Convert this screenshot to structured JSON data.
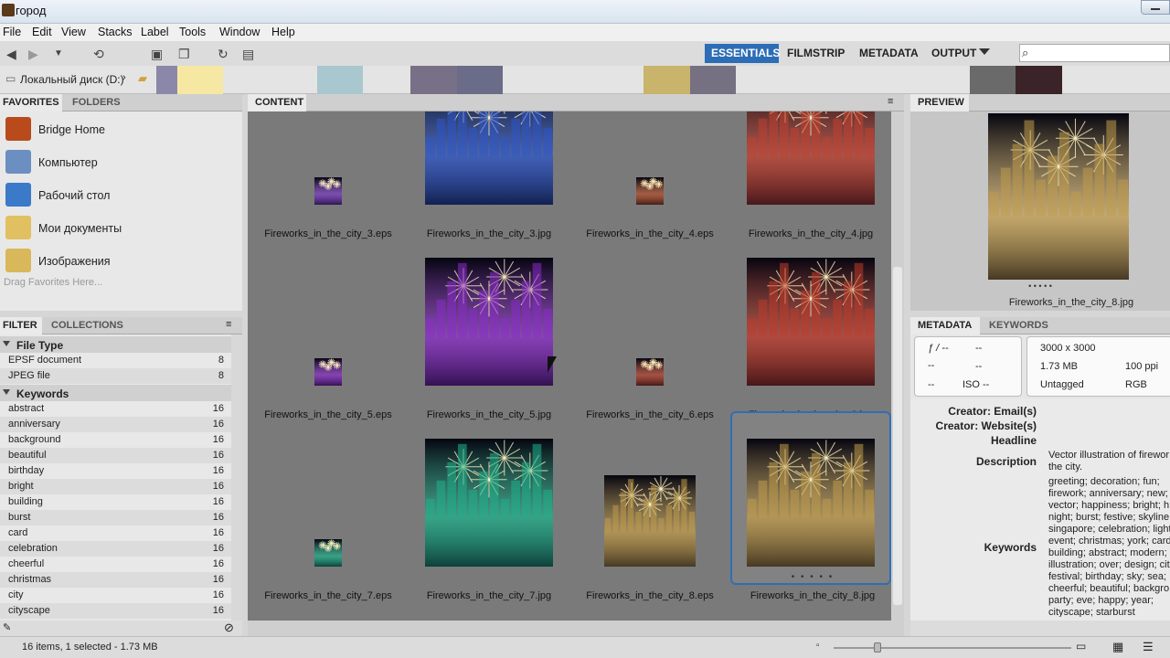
{
  "window": {
    "title": "город"
  },
  "menu": [
    "File",
    "Edit",
    "View",
    "Stacks",
    "Label",
    "Tools",
    "Window",
    "Help"
  ],
  "workspaces": {
    "active": "ESSENTIALS",
    "items": [
      "ESSENTIALS",
      "FILMSTRIP",
      "METADATA",
      "OUTPUT"
    ]
  },
  "search": {
    "placeholder": ""
  },
  "path": {
    "drive": "Локальный диск (D:)"
  },
  "favorites": {
    "tabs": [
      "FAVORITES",
      "FOLDERS"
    ],
    "items": [
      "Bridge Home",
      "Компьютер",
      "Рабочий стол",
      "Мои документы",
      "Изображения"
    ],
    "hint": "Drag Favorites Here..."
  },
  "filter": {
    "tabs": [
      "FILTER",
      "COLLECTIONS"
    ],
    "file_type_label": "File Type",
    "file_types": [
      {
        "name": "EPSF document",
        "count": "8"
      },
      {
        "name": "JPEG file",
        "count": "8"
      }
    ],
    "keywords_label": "Keywords",
    "keywords": [
      {
        "name": "abstract",
        "count": "16"
      },
      {
        "name": "anniversary",
        "count": "16"
      },
      {
        "name": "background",
        "count": "16"
      },
      {
        "name": "beautiful",
        "count": "16"
      },
      {
        "name": "birthday",
        "count": "16"
      },
      {
        "name": "bright",
        "count": "16"
      },
      {
        "name": "building",
        "count": "16"
      },
      {
        "name": "burst",
        "count": "16"
      },
      {
        "name": "card",
        "count": "16"
      },
      {
        "name": "celebration",
        "count": "16"
      },
      {
        "name": "cheerful",
        "count": "16"
      },
      {
        "name": "christmas",
        "count": "16"
      },
      {
        "name": "city",
        "count": "16"
      },
      {
        "name": "cityscape",
        "count": "16"
      }
    ]
  },
  "content": {
    "tab": "CONTENT",
    "items": [
      {
        "name": "Fireworks_in_the_city_3.eps",
        "kind": "small",
        "color": "#7a3cc4"
      },
      {
        "name": "Fireworks_in_the_city_3.jpg",
        "kind": "large",
        "color": "#2d56c8"
      },
      {
        "name": "Fireworks_in_the_city_4.eps",
        "kind": "small",
        "color": "#b4502a"
      },
      {
        "name": "Fireworks_in_the_city_4.jpg",
        "kind": "large",
        "color": "#c24030"
      },
      {
        "name": "Fireworks_in_the_city_5.eps",
        "kind": "small",
        "color": "#8a2cc8"
      },
      {
        "name": "Fireworks_in_the_city_5.jpg",
        "kind": "large",
        "color": "#8a2cc8"
      },
      {
        "name": "Fireworks_in_the_city_6.eps",
        "kind": "small",
        "color": "#b4402a"
      },
      {
        "name": "Fireworks_in_the_city_6.jpg",
        "kind": "large",
        "color": "#c03a2a"
      },
      {
        "name": "Fireworks_in_the_city_7.eps",
        "kind": "small",
        "color": "#1fb08a"
      },
      {
        "name": "Fireworks_in_the_city_7.jpg",
        "kind": "large",
        "color": "#1fb08a"
      },
      {
        "name": "Fireworks_in_the_city_8.eps",
        "kind": "medium",
        "color": "#c09a4a"
      },
      {
        "name": "Fireworks_in_the_city_8.jpg",
        "kind": "large",
        "color": "#c09a4a",
        "selected": true
      }
    ]
  },
  "preview": {
    "tab": "PREVIEW",
    "filename": "Fireworks_in_the_city_8.jpg",
    "dots": "• • • • •"
  },
  "metadata": {
    "tabs": [
      "METADATA",
      "KEYWORDS"
    ],
    "camera": {
      "aperture": "ƒ / --",
      "aperture_val": "--",
      "row2a": "--",
      "row2b": "--",
      "row3a": "--",
      "iso": "ISO --"
    },
    "info": {
      "dimensions": "3000 x 3000",
      "size": "1.73 MB",
      "ppi": "100 ppi",
      "tag": "Untagged",
      "mode": "RGB"
    },
    "fields": [
      {
        "key": "Creator: Email(s)",
        "value": ""
      },
      {
        "key": "Creator: Website(s)",
        "value": ""
      },
      {
        "key": "Headline",
        "value": ""
      },
      {
        "key": "Description",
        "value": "Vector illustration of firewor the city."
      },
      {
        "key": "Keywords",
        "value": "greeting; decoration; fun; firework; anniversary; new; vector; happiness; bright; h night; burst; festive; skyline singapore; celebration; light event; christmas; york; card building; abstract; modern; illustration; over; design; cit festival; birthday; sky; sea; cheerful; beautiful; backgro party; eve; happy; year; cityscape; starburst"
      }
    ]
  },
  "status": {
    "text": "16 items, 1 selected - 1.73 MB"
  },
  "colors": {
    "accent": "#2c6db5",
    "content_bg": "#7a7a7a"
  }
}
